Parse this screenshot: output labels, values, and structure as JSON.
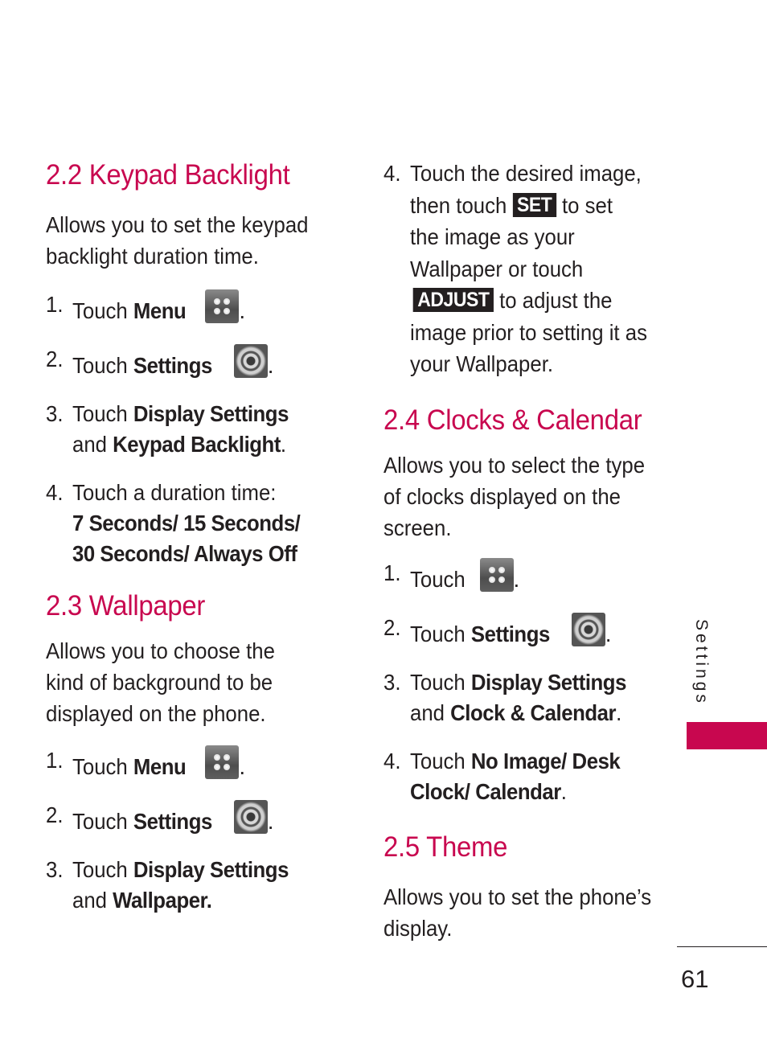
{
  "accent_color": "#c8074f",
  "sections": {
    "keypad": {
      "title": "2.2 Keypad Backlight",
      "desc": [
        "Allows you to set the keypad",
        "backlight duration time."
      ],
      "s1": {
        "num": "1.",
        "pre": "Touch ",
        "bold": "Menu",
        "icon": "menu-icon",
        "post": "."
      },
      "s2": {
        "num": "2.",
        "pre": "Touch ",
        "bold": "Settings",
        "icon": "settings-icon",
        "post": "."
      },
      "s3": {
        "num": "3.",
        "pre": "Touch ",
        "bold": "Display Settings",
        "line2_pre": "and ",
        "line2_bold": "Keypad Backlight",
        "line2_post": "."
      },
      "s4": {
        "num": "4.",
        "pre": "Touch a duration time:",
        "opt1": "7 Seconds/ 15 Seconds/",
        "opt2": "30 Seconds/ Always Off"
      }
    },
    "wallpaper": {
      "title": "2.3 Wallpaper",
      "desc": [
        "Allows you to choose the",
        "kind of background to be",
        "displayed on the phone."
      ],
      "s1": {
        "num": "1.",
        "pre": "Touch ",
        "bold": "Menu",
        "icon": "menu-icon",
        "post": "."
      },
      "s2": {
        "num": "2.",
        "pre": "Touch ",
        "bold": "Settings",
        "icon": "settings-icon",
        "post": "."
      },
      "s3": {
        "num": "3.",
        "pre": "Touch ",
        "bold": "Display Settings",
        "line2_pre": "and ",
        "line2_bold": "Wallpaper."
      },
      "s4": {
        "num": "4.",
        "l1": "Touch the desired image,",
        "l2_pre": "then touch ",
        "set_button": "SET",
        "l2_post": " to set",
        "l3": "the image as your",
        "l4": "Wallpaper or touch",
        "adjust_button": "ADJUST",
        "l5_post": " to adjust the",
        "l6": "image prior to setting it as",
        "l7": "your Wallpaper."
      }
    },
    "clocks": {
      "title": "2.4 Clocks & Calendar",
      "desc": [
        "Allows you to select the type",
        "of clocks displayed on the",
        "screen."
      ],
      "s1": {
        "num": "1.",
        "pre": "Touch ",
        "icon": "menu-icon",
        "post": "."
      },
      "s2": {
        "num": "2.",
        "pre": "Touch ",
        "bold": "Settings",
        "icon": "settings-icon",
        "post": "."
      },
      "s3": {
        "num": "3.",
        "pre": "Touch ",
        "bold": "Display Settings",
        "line2_pre": "and ",
        "line2_bold": "Clock & Calendar",
        "line2_post": "."
      },
      "s4": {
        "num": "4.",
        "pre": "Touch ",
        "bold": "No Image/ Desk",
        "line2_bold": "Clock/ Calendar",
        "line2_post": "."
      }
    },
    "theme": {
      "title": "2.5 Theme",
      "desc": [
        "Allows you to set the phone’s",
        "display."
      ]
    }
  },
  "side_tab": {
    "label": "Settings"
  },
  "page_number": "61"
}
